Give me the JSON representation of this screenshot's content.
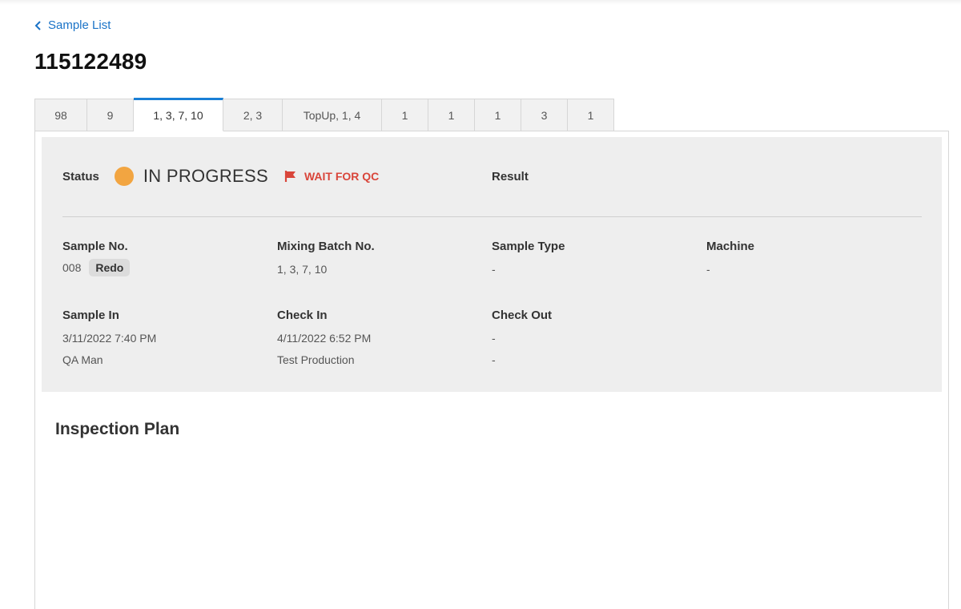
{
  "nav": {
    "back_label": "Sample List"
  },
  "page": {
    "title": "115122489"
  },
  "tabs": [
    {
      "label": "98",
      "width": 66
    },
    {
      "label": "9",
      "width": 58
    },
    {
      "label": "1, 3, 7, 10",
      "width": 112,
      "active": true
    },
    {
      "label": "2, 3",
      "width": 74
    },
    {
      "label": "TopUp, 1, 4",
      "width": 124
    },
    {
      "label": "1",
      "width": 58
    },
    {
      "label": "1",
      "width": 58
    },
    {
      "label": "1",
      "width": 58
    },
    {
      "label": "3",
      "width": 58
    },
    {
      "label": "1",
      "width": 58
    }
  ],
  "status": {
    "label": "Status",
    "value": "IN PROGRESS",
    "dot_color": "#f2a541",
    "flag_label": "WAIT FOR QC",
    "flag_color": "#d9453a",
    "result_label": "Result"
  },
  "details": {
    "sample_no": {
      "label": "Sample No.",
      "value": "008",
      "badge": "Redo"
    },
    "mixing_batch": {
      "label": "Mixing Batch No.",
      "value": "1, 3, 7, 10"
    },
    "sample_type": {
      "label": "Sample Type",
      "value": "-"
    },
    "machine": {
      "label": "Machine",
      "value": "-"
    },
    "sample_in": {
      "label": "Sample In",
      "time": "3/11/2022 7:40 PM",
      "user": "QA Man"
    },
    "check_in": {
      "label": "Check In",
      "time": "4/11/2022 6:52 PM",
      "user": "Test Production"
    },
    "check_out": {
      "label": "Check Out",
      "time": "-",
      "user": "-"
    }
  },
  "inspection": {
    "title": "Inspection Plan"
  },
  "colors": {
    "accent": "#1a7fd6",
    "link": "#1a73c7",
    "panel_bg": "#eeeeee"
  }
}
